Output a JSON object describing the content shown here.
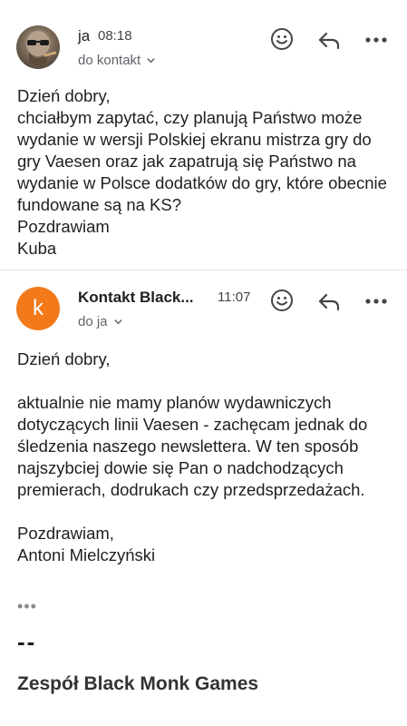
{
  "message1": {
    "sender": "ja",
    "time": "08:18",
    "recipient": "do kontakt",
    "body": "Dzień dobry,\nchciałbym zapytać, czy planują Państwo może wydanie w wersji Polskiej ekranu mistrza gry do gry Vaesen oraz jak zapatrują się Państwo na wydanie w Polsce dodatków do gry, które obecnie fundowane są na KS?\nPozdrawiam\nKuba"
  },
  "message2": {
    "avatar_letter": "k",
    "sender": "Kontakt Black...",
    "time": "11:07",
    "recipient": "do ja",
    "body": "Dzień dobry,\n\naktualnie nie mamy planów wydawniczych dotyczących linii Vaesen - zachęcam jednak do śledzenia naszego newslettera. W ten sposób najszybciej dowie się Pan o nadchodzących premierach, dodrukach czy przedsprzedażach.\n\nPozdrawiam,\nAntoni Mielczyński",
    "ellipsis": "•••",
    "signature_dash": "--",
    "signature_team": "Zespół Black Monk Games"
  },
  "icons": [
    "emoji-icon",
    "reply-icon",
    "more-icon",
    "chevron-down-icon"
  ],
  "colors": {
    "avatar_orange": "#f27a1a",
    "text": "#1f1f1f",
    "secondary": "#5f6368"
  }
}
